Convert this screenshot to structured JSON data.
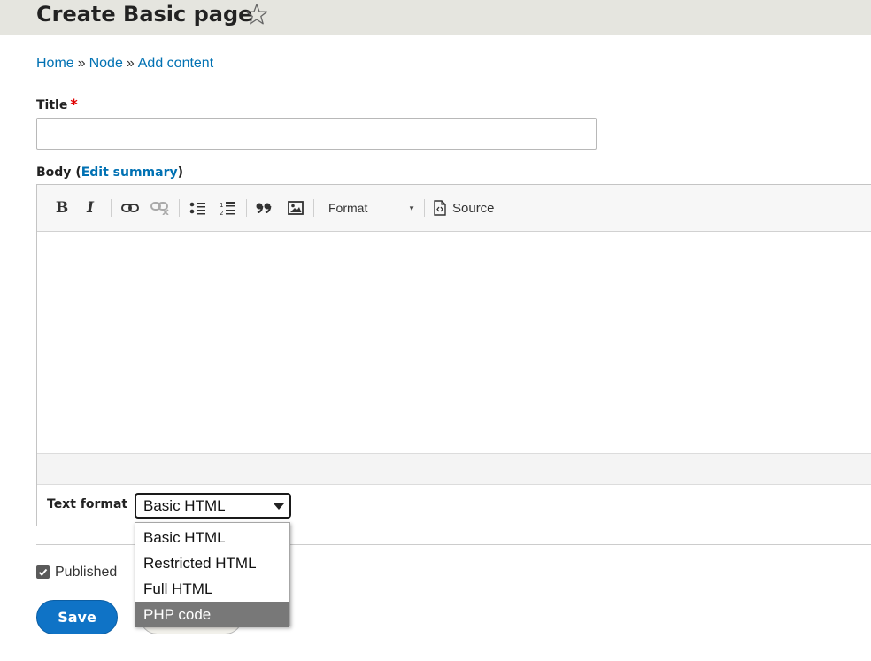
{
  "page": {
    "title": "Create Basic page",
    "favorite_icon": "star-outline-icon"
  },
  "breadcrumb": {
    "items": [
      "Home",
      "Node",
      "Add content"
    ],
    "separator": "»"
  },
  "form": {
    "title_label": "Title",
    "required_marker": "*",
    "title_value": "",
    "body_label": "Body",
    "body_paren_open": "(",
    "edit_summary_label": "Edit summary",
    "body_paren_close": ")"
  },
  "toolbar": {
    "bold_label": "B",
    "italic_label": "I",
    "format_label": "Format",
    "source_label": "Source",
    "icons": [
      "bold-icon",
      "italic-icon",
      "link-icon",
      "unlink-icon",
      "bulleted-list-icon",
      "numbered-list-icon",
      "blockquote-icon",
      "image-icon",
      "source-icon"
    ]
  },
  "text_format": {
    "label": "Text format",
    "selected": "Basic HTML",
    "options": [
      "Basic HTML",
      "Restricted HTML",
      "Full HTML",
      "PHP code"
    ],
    "highlighted_index": 3
  },
  "published": {
    "label": "Published",
    "checked": true
  },
  "actions": {
    "save_label": "Save",
    "preview_label": "Preview"
  },
  "colors": {
    "link": "#0071b3",
    "primary_button": "#0f73c6",
    "required": "#e00000",
    "header_bg": "#e5e5df",
    "highlight": "#787878"
  }
}
